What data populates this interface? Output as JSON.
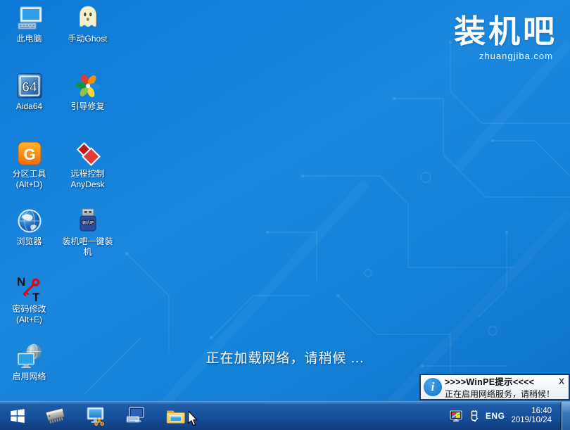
{
  "desktop": {
    "loading_text": "正在加载网络，请稍候 ...",
    "logo": {
      "title": "装机吧",
      "subtitle": "zhuangjiba.com"
    },
    "icons": [
      {
        "name": "this-pc",
        "label": "此电脑",
        "icon": "computer-icon"
      },
      {
        "name": "manual-ghost",
        "label": "手动Ghost",
        "icon": "ghost-icon"
      },
      {
        "name": "aida64",
        "label": "Aida64",
        "icon": "aida64-icon",
        "glyph": "64"
      },
      {
        "name": "boot-repair",
        "label": "引导修复",
        "icon": "pinwheel-icon"
      },
      {
        "name": "partition-tool",
        "label": "分区工具",
        "label2": "(Alt+D)",
        "icon": "diskgenius-icon",
        "glyph": "G"
      },
      {
        "name": "remote-control-anydesk",
        "label": "远程控制",
        "label2": "AnyDesk",
        "icon": "anydesk-icon"
      },
      {
        "name": "browser",
        "label": "浏览器",
        "icon": "globe-icon"
      },
      {
        "name": "one-click-install",
        "label": "装机吧一键装机",
        "icon": "usb-drive-icon",
        "glyph": "装机吧"
      },
      {
        "name": "password-reset",
        "label": "密码修改",
        "label2": "(Alt+E)",
        "icon": "nt-key-icon",
        "glyph_n": "N",
        "glyph_t": "T"
      },
      {
        "name": "enable-network",
        "label": "启用网络",
        "icon": "network-globe-icon"
      }
    ]
  },
  "notification": {
    "title": ">>>>WinPE提示<<<<",
    "close_label": "X",
    "message": "正在启用网络服务，请稍候！",
    "info_glyph": "i"
  },
  "taskbar": {
    "buttons": [
      "start",
      "memory-chip",
      "screen-capture",
      "on-screen-keyboard",
      "file-explorer"
    ],
    "tray": {
      "language": "ENG",
      "time": "16:40",
      "date": "2019/10/24"
    }
  },
  "colors": {
    "desktop_top": "#0c79d6",
    "desktop_bottom": "#0d71c6",
    "taskbar": "#164f9b",
    "notification_border": "#15386e",
    "info_accent": "#1272c8"
  }
}
